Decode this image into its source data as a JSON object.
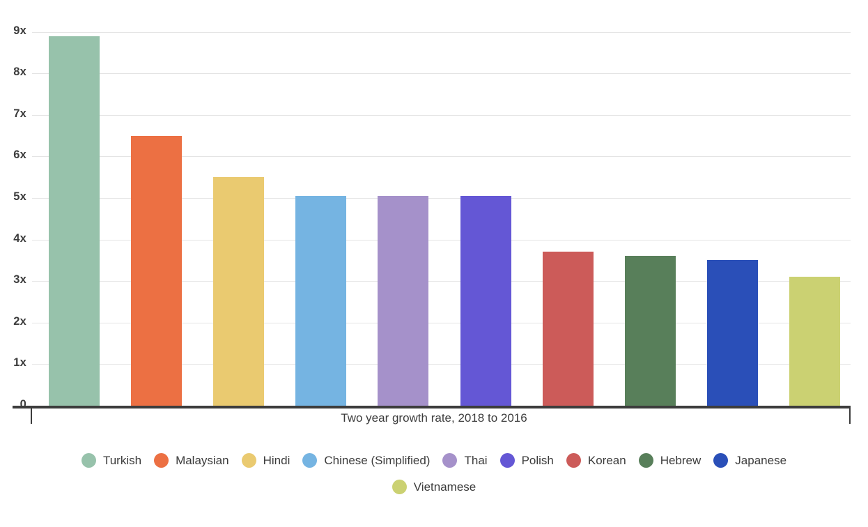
{
  "chart_data": {
    "type": "bar",
    "title": "",
    "subtitle": "",
    "xlabel": "Two year growth rate, 2018 to 2016",
    "ylabel": "",
    "categories": [
      "Turkish",
      "Malaysian",
      "Hindi",
      "Chinese (Simplified)",
      "Thai",
      "Polish",
      "Korean",
      "Hebrew",
      "Japanese",
      "Vietnamese"
    ],
    "values": [
      8.9,
      6.5,
      5.5,
      5.05,
      5.05,
      5.05,
      3.7,
      3.6,
      3.5,
      3.1
    ],
    "ylim": [
      0,
      9.2
    ],
    "ytick_labels": [
      "9x",
      "8x",
      "7x",
      "6x",
      "5x",
      "4x",
      "3x",
      "2x",
      "1x",
      "0"
    ],
    "ytick_values": [
      9,
      8,
      7,
      6,
      5,
      4,
      3,
      2,
      1,
      0
    ],
    "grid": true,
    "legend_position": "bottom",
    "colors": [
      "#97c2ab",
      "#ec7043",
      "#eaca70",
      "#75b4e2",
      "#a591ca",
      "#6457d5",
      "#cc5b59",
      "#587f5a",
      "#2a4fb8",
      "#cbd172"
    ],
    "series": [
      {
        "name": "Two year growth rate, 2018 to 2016",
        "points": [
          {
            "label": "Turkish",
            "value": 8.9,
            "color": "#97c2ab"
          },
          {
            "label": "Malaysian",
            "value": 6.5,
            "color": "#ec7043"
          },
          {
            "label": "Hindi",
            "value": 5.5,
            "color": "#eaca70"
          },
          {
            "label": "Chinese (Simplified)",
            "value": 5.05,
            "color": "#75b4e2"
          },
          {
            "label": "Thai",
            "value": 5.05,
            "color": "#a591ca"
          },
          {
            "label": "Polish",
            "value": 5.05,
            "color": "#6457d5"
          },
          {
            "label": "Korean",
            "value": 3.7,
            "color": "#cc5b59"
          },
          {
            "label": "Hebrew",
            "value": 3.6,
            "color": "#587f5a"
          },
          {
            "label": "Japanese",
            "value": 3.5,
            "color": "#2a4fb8"
          },
          {
            "label": "Vietnamese",
            "value": 3.1,
            "color": "#cbd172"
          }
        ]
      }
    ],
    "legend": [
      {
        "label": "Turkish",
        "color": "#97c2ab"
      },
      {
        "label": "Malaysian",
        "color": "#ec7043"
      },
      {
        "label": "Hindi",
        "color": "#eaca70"
      },
      {
        "label": "Chinese (Simplified)",
        "color": "#75b4e2"
      },
      {
        "label": "Thai",
        "color": "#a591ca"
      },
      {
        "label": "Polish",
        "color": "#6457d5"
      },
      {
        "label": "Korean",
        "color": "#cc5b59"
      },
      {
        "label": "Hebrew",
        "color": "#587f5a"
      },
      {
        "label": "Japanese",
        "color": "#2a4fb8"
      },
      {
        "label": "Vietnamese",
        "color": "#cbd172"
      }
    ],
    "legend_rows": [
      [
        "Turkish",
        "Malaysian",
        "Hindi",
        "Chinese (Simplified)",
        "Thai",
        "Polish",
        "Korean",
        "Hebrew",
        "Japanese"
      ],
      [
        "Vietnamese"
      ]
    ]
  },
  "axis": {
    "tick_color": "#3c3c3c",
    "grid_color": "#e4e4e4",
    "axis_color": "#3c3c3c"
  }
}
